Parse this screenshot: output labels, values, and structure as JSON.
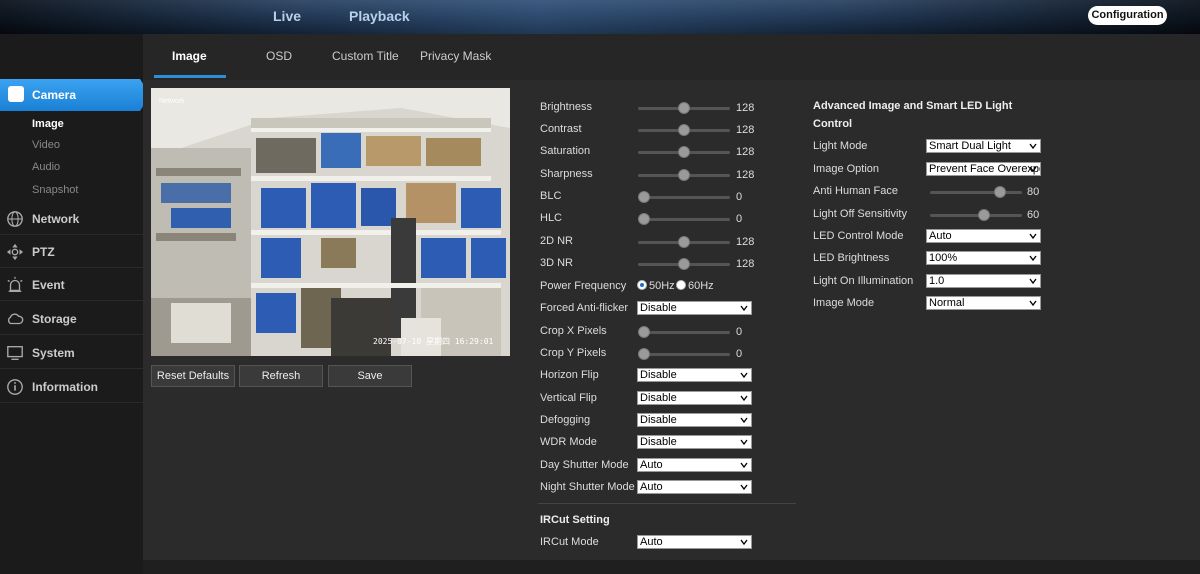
{
  "topnav": {
    "live": "Live",
    "playback": "Playback",
    "configuration": "Configuration"
  },
  "tabs": [
    "Image",
    "OSD",
    "Custom Title",
    "Privacy Mask"
  ],
  "sidebar": {
    "camera": "Camera",
    "camera_sub": [
      "Image",
      "Video",
      "Audio",
      "Snapshot"
    ],
    "items": [
      "Network",
      "PTZ",
      "Event",
      "Storage",
      "System",
      "Information"
    ]
  },
  "preview": {
    "osd_top": "Network",
    "timestamp": "2025-07-10 星期四 16:29:01"
  },
  "buttons": {
    "reset": "Reset Defaults",
    "refresh": "Refresh",
    "save": "Save"
  },
  "image_settings": {
    "brightness": {
      "label": "Brightness",
      "value": "128",
      "level": 0.5
    },
    "contrast": {
      "label": "Contrast",
      "value": "128",
      "level": 0.5
    },
    "saturation": {
      "label": "Saturation",
      "value": "128",
      "level": 0.5
    },
    "sharpness": {
      "label": "Sharpness",
      "value": "128",
      "level": 0.5
    },
    "blc": {
      "label": "BLC",
      "value": "0",
      "level": 0
    },
    "hlc": {
      "label": "HLC",
      "value": "0",
      "level": 0
    },
    "nr2d": {
      "label": "2D NR",
      "value": "128",
      "level": 0.5
    },
    "nr3d": {
      "label": "3D NR",
      "value": "128",
      "level": 0.5
    },
    "power_frequency": {
      "label": "Power Frequency",
      "opt1": "50Hz",
      "opt2": "60Hz",
      "selected": "50Hz"
    },
    "anti_flicker": {
      "label": "Forced Anti-flicker",
      "value": "Disable"
    },
    "crop_x": {
      "label": "Crop X Pixels",
      "value": "0",
      "level": 0
    },
    "crop_y": {
      "label": "Crop Y Pixels",
      "value": "0",
      "level": 0
    },
    "horizon_flip": {
      "label": "Horizon Flip",
      "value": "Disable"
    },
    "vertical_flip": {
      "label": "Vertical Flip",
      "value": "Disable"
    },
    "defogging": {
      "label": "Defogging",
      "value": "Disable"
    },
    "wdr_mode": {
      "label": "WDR Mode",
      "value": "Disable"
    },
    "day_shutter": {
      "label": "Day Shutter Mode",
      "value": "Auto"
    },
    "night_shutter": {
      "label": "Night Shutter Mode",
      "value": "Auto"
    }
  },
  "ircut": {
    "title": "IRCut Setting",
    "label": "IRCut Mode",
    "value": "Auto"
  },
  "led": {
    "title_line1": "Advanced Image and Smart LED Light",
    "title_line2": "Control",
    "light_mode": {
      "label": "Light Mode",
      "value": "Smart Dual Light"
    },
    "image_option": {
      "label": "Image Option",
      "value": "Prevent Face Overexposure"
    },
    "anti_human_face": {
      "label": "Anti Human Face",
      "value": "80",
      "level": 0.8
    },
    "light_off_sensitivity": {
      "label": "Light Off Sensitivity",
      "value": "60",
      "level": 0.6
    },
    "led_control_mode": {
      "label": "LED Control Mode",
      "value": "Auto"
    },
    "led_brightness": {
      "label": "LED Brightness",
      "value": "100%"
    },
    "light_on_illumination": {
      "label": "Light On Illumination",
      "value": "1.0"
    },
    "image_mode": {
      "label": "Image Mode",
      "value": "Normal"
    }
  },
  "colors": {
    "accent": "#2e8fd6",
    "background": "#2b2b2b",
    "sidebar": "#1b1b1b"
  }
}
